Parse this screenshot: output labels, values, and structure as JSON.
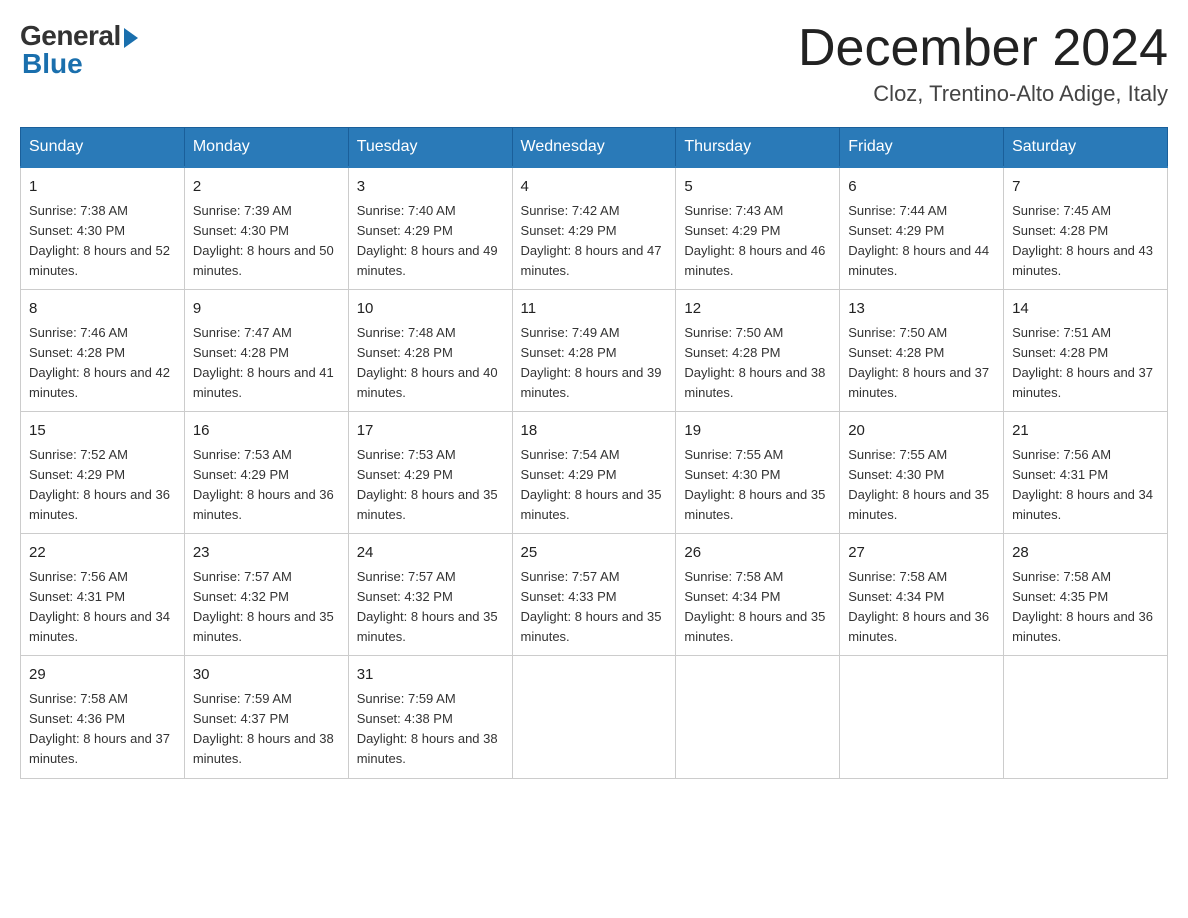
{
  "logo": {
    "general": "General",
    "blue": "Blue"
  },
  "header": {
    "month": "December 2024",
    "location": "Cloz, Trentino-Alto Adige, Italy"
  },
  "days_of_week": [
    "Sunday",
    "Monday",
    "Tuesday",
    "Wednesday",
    "Thursday",
    "Friday",
    "Saturday"
  ],
  "weeks": [
    [
      {
        "day": "1",
        "sunrise": "7:38 AM",
        "sunset": "4:30 PM",
        "daylight": "8 hours and 52 minutes."
      },
      {
        "day": "2",
        "sunrise": "7:39 AM",
        "sunset": "4:30 PM",
        "daylight": "8 hours and 50 minutes."
      },
      {
        "day": "3",
        "sunrise": "7:40 AM",
        "sunset": "4:29 PM",
        "daylight": "8 hours and 49 minutes."
      },
      {
        "day": "4",
        "sunrise": "7:42 AM",
        "sunset": "4:29 PM",
        "daylight": "8 hours and 47 minutes."
      },
      {
        "day": "5",
        "sunrise": "7:43 AM",
        "sunset": "4:29 PM",
        "daylight": "8 hours and 46 minutes."
      },
      {
        "day": "6",
        "sunrise": "7:44 AM",
        "sunset": "4:29 PM",
        "daylight": "8 hours and 44 minutes."
      },
      {
        "day": "7",
        "sunrise": "7:45 AM",
        "sunset": "4:28 PM",
        "daylight": "8 hours and 43 minutes."
      }
    ],
    [
      {
        "day": "8",
        "sunrise": "7:46 AM",
        "sunset": "4:28 PM",
        "daylight": "8 hours and 42 minutes."
      },
      {
        "day": "9",
        "sunrise": "7:47 AM",
        "sunset": "4:28 PM",
        "daylight": "8 hours and 41 minutes."
      },
      {
        "day": "10",
        "sunrise": "7:48 AM",
        "sunset": "4:28 PM",
        "daylight": "8 hours and 40 minutes."
      },
      {
        "day": "11",
        "sunrise": "7:49 AM",
        "sunset": "4:28 PM",
        "daylight": "8 hours and 39 minutes."
      },
      {
        "day": "12",
        "sunrise": "7:50 AM",
        "sunset": "4:28 PM",
        "daylight": "8 hours and 38 minutes."
      },
      {
        "day": "13",
        "sunrise": "7:50 AM",
        "sunset": "4:28 PM",
        "daylight": "8 hours and 37 minutes."
      },
      {
        "day": "14",
        "sunrise": "7:51 AM",
        "sunset": "4:28 PM",
        "daylight": "8 hours and 37 minutes."
      }
    ],
    [
      {
        "day": "15",
        "sunrise": "7:52 AM",
        "sunset": "4:29 PM",
        "daylight": "8 hours and 36 minutes."
      },
      {
        "day": "16",
        "sunrise": "7:53 AM",
        "sunset": "4:29 PM",
        "daylight": "8 hours and 36 minutes."
      },
      {
        "day": "17",
        "sunrise": "7:53 AM",
        "sunset": "4:29 PM",
        "daylight": "8 hours and 35 minutes."
      },
      {
        "day": "18",
        "sunrise": "7:54 AM",
        "sunset": "4:29 PM",
        "daylight": "8 hours and 35 minutes."
      },
      {
        "day": "19",
        "sunrise": "7:55 AM",
        "sunset": "4:30 PM",
        "daylight": "8 hours and 35 minutes."
      },
      {
        "day": "20",
        "sunrise": "7:55 AM",
        "sunset": "4:30 PM",
        "daylight": "8 hours and 35 minutes."
      },
      {
        "day": "21",
        "sunrise": "7:56 AM",
        "sunset": "4:31 PM",
        "daylight": "8 hours and 34 minutes."
      }
    ],
    [
      {
        "day": "22",
        "sunrise": "7:56 AM",
        "sunset": "4:31 PM",
        "daylight": "8 hours and 34 minutes."
      },
      {
        "day": "23",
        "sunrise": "7:57 AM",
        "sunset": "4:32 PM",
        "daylight": "8 hours and 35 minutes."
      },
      {
        "day": "24",
        "sunrise": "7:57 AM",
        "sunset": "4:32 PM",
        "daylight": "8 hours and 35 minutes."
      },
      {
        "day": "25",
        "sunrise": "7:57 AM",
        "sunset": "4:33 PM",
        "daylight": "8 hours and 35 minutes."
      },
      {
        "day": "26",
        "sunrise": "7:58 AM",
        "sunset": "4:34 PM",
        "daylight": "8 hours and 35 minutes."
      },
      {
        "day": "27",
        "sunrise": "7:58 AM",
        "sunset": "4:34 PM",
        "daylight": "8 hours and 36 minutes."
      },
      {
        "day": "28",
        "sunrise": "7:58 AM",
        "sunset": "4:35 PM",
        "daylight": "8 hours and 36 minutes."
      }
    ],
    [
      {
        "day": "29",
        "sunrise": "7:58 AM",
        "sunset": "4:36 PM",
        "daylight": "8 hours and 37 minutes."
      },
      {
        "day": "30",
        "sunrise": "7:59 AM",
        "sunset": "4:37 PM",
        "daylight": "8 hours and 38 minutes."
      },
      {
        "day": "31",
        "sunrise": "7:59 AM",
        "sunset": "4:38 PM",
        "daylight": "8 hours and 38 minutes."
      },
      null,
      null,
      null,
      null
    ]
  ]
}
